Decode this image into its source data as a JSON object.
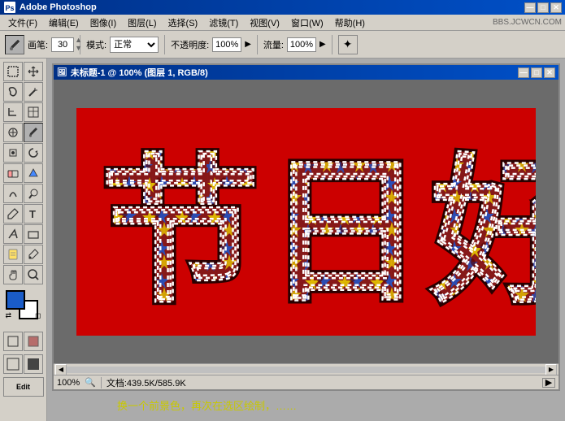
{
  "app": {
    "title": "Adobe Photoshop",
    "bbs_tag": "BBS.JCWCN.COM"
  },
  "menu": {
    "items": [
      {
        "label": "文件(F)"
      },
      {
        "label": "编辑(E)"
      },
      {
        "label": "图像(I)"
      },
      {
        "label": "图层(L)"
      },
      {
        "label": "选择(S)"
      },
      {
        "label": "滤镜(T)"
      },
      {
        "label": "视图(V)"
      },
      {
        "label": "窗口(W)"
      },
      {
        "label": "帮助(H)"
      }
    ]
  },
  "toolbar": {
    "brush_label": "画笔:",
    "brush_size": "30",
    "mode_label": "模式:",
    "mode_value": "正常",
    "opacity_label": "不透明度:",
    "opacity_value": "100%",
    "flow_label": "流量:",
    "flow_value": "100%"
  },
  "document": {
    "title": "未标题-1 @ 100% (图层 1, RGB/8)",
    "zoom": "100%",
    "status": "文档:439.5K/585.9K"
  },
  "canvas": {
    "text": "节日好",
    "bg_color": "#cc0000"
  },
  "bottom_text": "换一个前景色，再次在选区绘制，……",
  "win_buttons": {
    "minimize": "—",
    "maximize": "□",
    "close": "✕"
  }
}
